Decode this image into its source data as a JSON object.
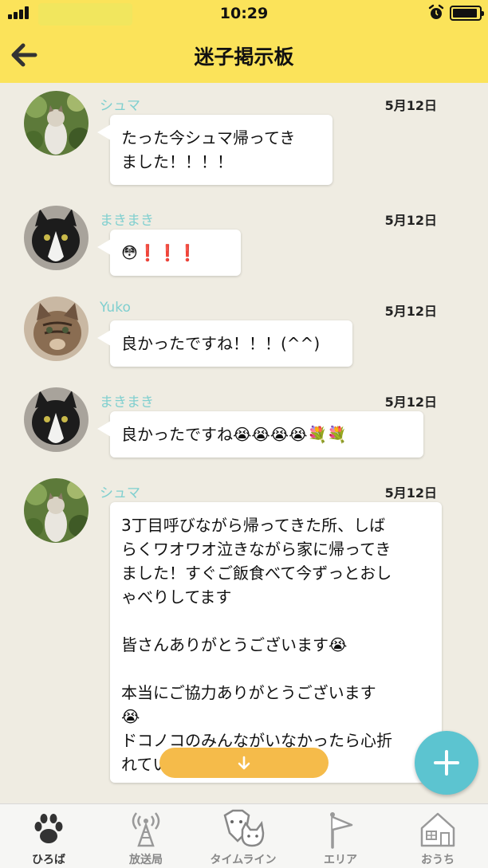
{
  "status": {
    "time": "10:29"
  },
  "header": {
    "title": "迷子掲示板"
  },
  "posts": [
    {
      "name": "シュマ",
      "date": "5月12日",
      "text": "たった今シュマ帰ってき\nました！！！！"
    },
    {
      "name": "まきまき",
      "date": "5月12日",
      "text": "😳❗❗❗"
    },
    {
      "name": "Yuko",
      "date": "5月12日",
      "text": "良かったですね！！！(^^)"
    },
    {
      "name": "まきまき",
      "date": "5月12日",
      "text": "良かったですね😭😭😭😭💐💐"
    },
    {
      "name": "シュマ",
      "date": "5月12日",
      "text": "3丁目呼びながら帰ってきた所、しば\nらくワオワオ泣きながら家に帰ってき\nました！すぐご飯食べて今ずっとおし\nゃべりしてます\n\n皆さんありがとうございます😭\n\n本当にご協力ありがとうございます\n😭\nドコノコのみんながいなかったら心折\nれてい"
    }
  ],
  "tabs": [
    {
      "label": "ひろば",
      "icon": "paw-icon",
      "active": true
    },
    {
      "label": "放送局",
      "icon": "broadcast-tower-icon",
      "active": false
    },
    {
      "label": "タイムライン",
      "icon": "dog-cat-icon",
      "active": false
    },
    {
      "label": "エリア",
      "icon": "flag-icon",
      "active": false
    },
    {
      "label": "おうち",
      "icon": "house-icon",
      "active": false
    }
  ],
  "colors": {
    "header": "#fbe35a",
    "username": "#7fcfcf",
    "fab": "#5cc4d0",
    "scroll_button": "#f5bb4a",
    "background": "#efece2"
  }
}
